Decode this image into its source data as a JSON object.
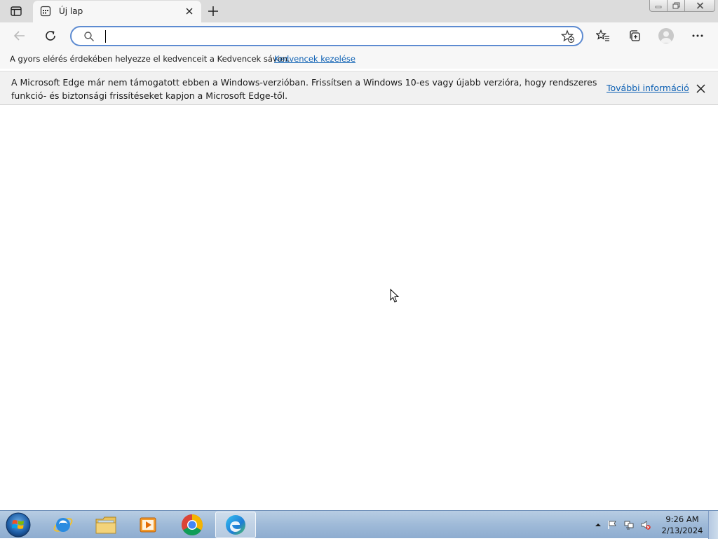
{
  "tabs": [
    {
      "title": "Új lap",
      "active": true
    }
  ],
  "address_bar": {
    "value": "",
    "placeholder": ""
  },
  "favorites_bar": {
    "message": "A gyors elérés érdekében helyezze el kedvenceit a Kedvencek sávon.",
    "manage_link": "Kedvencek kezelése"
  },
  "info_bar": {
    "message": "A Microsoft Edge már nem támogatott ebben a Windows-verzióban. Frissítsen a Windows 10-es vagy újabb verzióra, hogy rendszeres funkció- és biztonsági frissítéseket kapjon a Microsoft Edge-től.",
    "more_info_link": "További információ"
  },
  "taskbar": {
    "apps": [
      {
        "name": "internet-explorer-icon",
        "active": false
      },
      {
        "name": "file-explorer-icon",
        "active": false
      },
      {
        "name": "media-player-icon",
        "active": false
      },
      {
        "name": "chrome-icon",
        "active": false
      },
      {
        "name": "edge-icon",
        "active": true
      }
    ],
    "clock_time": "9:26 AM",
    "clock_date": "2/13/2024"
  },
  "colors": {
    "accent": "#0b5fb3",
    "address_border": "#5d8bd1",
    "tabstrip": "#dcdcdc",
    "toolbar": "#f7f7f7"
  }
}
